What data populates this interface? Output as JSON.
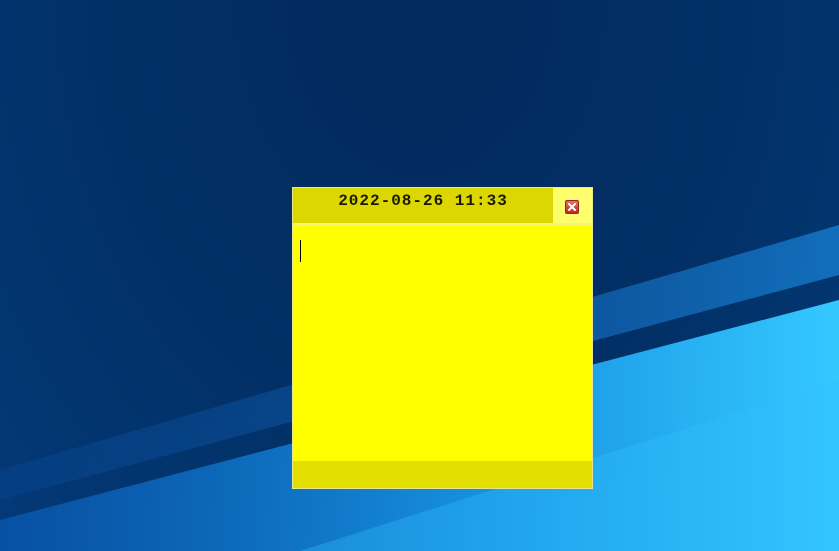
{
  "desktop": {
    "colors": {
      "background": "#023066",
      "light_streak": "#0a8ff0"
    }
  },
  "sticky_note": {
    "title": "2022-08-26 11:33",
    "body_text": "",
    "close_icon": "close-icon",
    "colors": {
      "note": "#ffff00",
      "titlebar": "#dcd700",
      "footer": "#e2df00",
      "close_button": "#d0392d"
    }
  }
}
